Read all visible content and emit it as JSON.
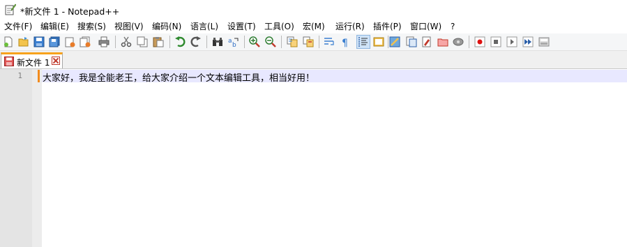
{
  "window": {
    "title": "*新文件 1 - Notepad++"
  },
  "menu": {
    "items": [
      "文件(F)",
      "编辑(E)",
      "搜索(S)",
      "视图(V)",
      "编码(N)",
      "语言(L)",
      "设置(T)",
      "工具(O)",
      "宏(M)",
      "运行(R)",
      "插件(P)",
      "窗口(W)",
      "?"
    ]
  },
  "toolbar": {
    "icons": [
      "new-file-icon",
      "open-file-icon",
      "save-icon",
      "save-all-icon",
      "close-icon",
      "close-all-icon",
      "print-icon",
      "cut-icon",
      "copy-icon",
      "paste-icon",
      "undo-icon",
      "redo-icon",
      "find-icon",
      "replace-icon",
      "zoom-in-icon",
      "zoom-out-icon",
      "sync-vertical-icon",
      "sync-horizontal-icon",
      "word-wrap-icon",
      "show-all-chars-icon",
      "indent-guide-icon",
      "doc-map-icon",
      "function-list-icon",
      "folder-workspace-icon",
      "doc-switcher-icon",
      "monitoring-icon",
      "record-macro-icon",
      "stop-macro-icon",
      "play-macro-icon",
      "run-macro-multiple-icon",
      "save-macro-icon"
    ]
  },
  "tabs": [
    {
      "label": "新文件 1"
    }
  ],
  "editor": {
    "lines": [
      {
        "number": "1",
        "text": "大家好，我是全能老王，给大家介绍一个文本编辑工具，相当好用！"
      }
    ]
  }
}
